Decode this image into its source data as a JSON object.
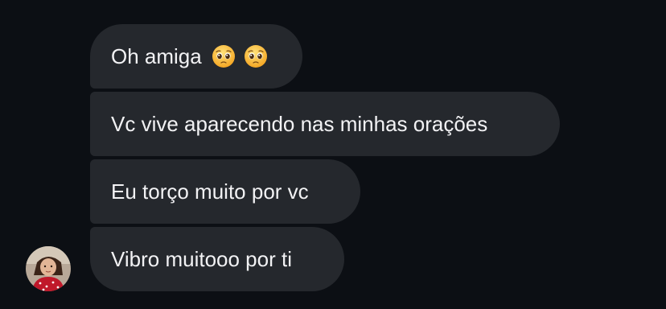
{
  "messages": [
    {
      "text": "Oh amiga",
      "emojis": [
        "pleading-face",
        "pleading-face"
      ]
    },
    {
      "text": "Vc vive aparecendo nas minhas orações"
    },
    {
      "text": "Eu torço muito por vc"
    },
    {
      "text": "Vibro muitooo por ti"
    }
  ],
  "sender": {
    "avatar": "avatar-photo"
  },
  "colors": {
    "background": "#0c0f14",
    "bubble": "#25282d",
    "text": "#f2f2f4",
    "emoji_face": "#ffca3a"
  }
}
